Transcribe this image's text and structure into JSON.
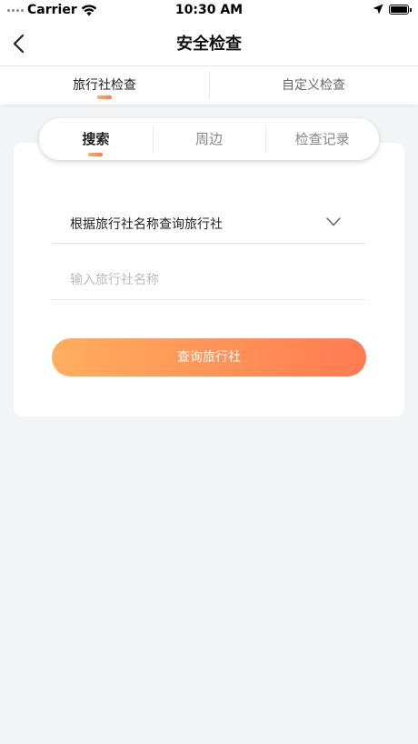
{
  "status_bar": {
    "carrier": "Carrier",
    "time": "10:30 AM"
  },
  "nav": {
    "title": "安全检查"
  },
  "top_tabs": [
    {
      "label": "旅行社检查",
      "active": true
    },
    {
      "label": "自定义检查",
      "active": false
    }
  ],
  "segment_tabs": [
    {
      "label": "搜索",
      "active": true
    },
    {
      "label": "周边",
      "active": false
    },
    {
      "label": "检查记录",
      "active": false
    }
  ],
  "form": {
    "select_label": "根据旅行社名称查询旅行社",
    "name_input_value": "",
    "name_input_placeholder": "输入旅行社名称",
    "submit_label": "查询旅行社"
  },
  "colors": {
    "accent_start": "#ffae5e",
    "accent_end": "#ff7b52",
    "background": "#f3f4f6"
  },
  "icons": [
    "back-chevron-icon",
    "wifi-icon",
    "location-arrow-icon",
    "battery-icon",
    "chevron-down-icon"
  ]
}
